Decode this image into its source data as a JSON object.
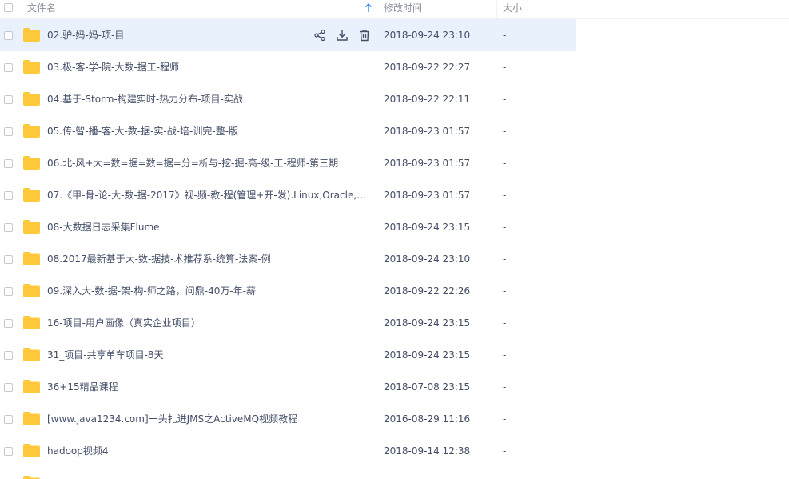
{
  "header": {
    "name_label": "文件名",
    "modified_label": "修改时间",
    "size_label": "大小"
  },
  "colors": {
    "folder": "#ffc93c",
    "folder_dark": "#f5b820",
    "selected_row": "#e9f1fd",
    "sort_arrow": "#3c8af2",
    "text": "#424e67",
    "header_text": "#888f9c"
  },
  "icons": {
    "sort": "arrow-up-icon",
    "share": "share-icon",
    "download": "download-icon",
    "delete": "trash-icon",
    "folder": "folder-icon"
  },
  "files": [
    {
      "name": "02.驴-妈-妈-项-目",
      "modified": "2018-09-24 23:10",
      "size": "-",
      "selected": true
    },
    {
      "name": "03.极-客-学-院-大数-据工-程师",
      "modified": "2018-09-22 22:27",
      "size": "-"
    },
    {
      "name": "04.基于-Storm-构建实时-热力分布-项目-实战",
      "modified": "2018-09-22 22:11",
      "size": "-"
    },
    {
      "name": "05.传-智-播-客-大-数-据-实-战-培-训完-整-版",
      "modified": "2018-09-23 01:57",
      "size": "-"
    },
    {
      "name": "06.北-风+大=数=据=数=据=分=析与-挖-掘-高-级-工-程师-第三期",
      "modified": "2018-09-23 01:57",
      "size": "-"
    },
    {
      "name": "07.《甲-骨-论-大-数-据-2017》视-频-教-程(管理+开-发).Linux,Oracle,M...",
      "modified": "2018-09-23 01:57",
      "size": "-"
    },
    {
      "name": "08-大数据日志采集Flume",
      "modified": "2018-09-24 23:15",
      "size": "-"
    },
    {
      "name": "08.2017最新基于大-数-据技-术推荐系-统算-法案-例",
      "modified": "2018-09-24 23:10",
      "size": "-"
    },
    {
      "name": "09.深入大-数-据-架-构-师之路，问鼎-40万-年-薪",
      "modified": "2018-09-22 22:26",
      "size": "-"
    },
    {
      "name": "16-项目-用户画像（真实企业项目）",
      "modified": "2018-09-24 23:15",
      "size": "-"
    },
    {
      "name": "31_项目-共享单车项目-8天",
      "modified": "2018-09-24 23:15",
      "size": "-"
    },
    {
      "name": "36+15精品课程",
      "modified": "2018-07-08 23:15",
      "size": "-"
    },
    {
      "name": "[www.java1234.com]一头扎进JMS之ActiveMQ视频教程",
      "modified": "2016-08-29 11:16",
      "size": "-"
    },
    {
      "name": "hadoop视频4",
      "modified": "2018-09-14 12:38",
      "size": "-"
    }
  ]
}
